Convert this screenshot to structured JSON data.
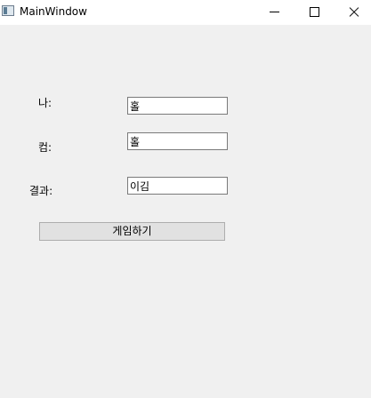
{
  "window": {
    "title": "MainWindow",
    "buttons": [
      "minimize-icon",
      "maximize-icon",
      "close-icon"
    ]
  },
  "form": {
    "me_label": "나:",
    "me_value": "홀",
    "com_label": "컴:",
    "com_value": "홀",
    "result_label": "결과:",
    "result_value": "이김",
    "play_button": "게임하기"
  }
}
